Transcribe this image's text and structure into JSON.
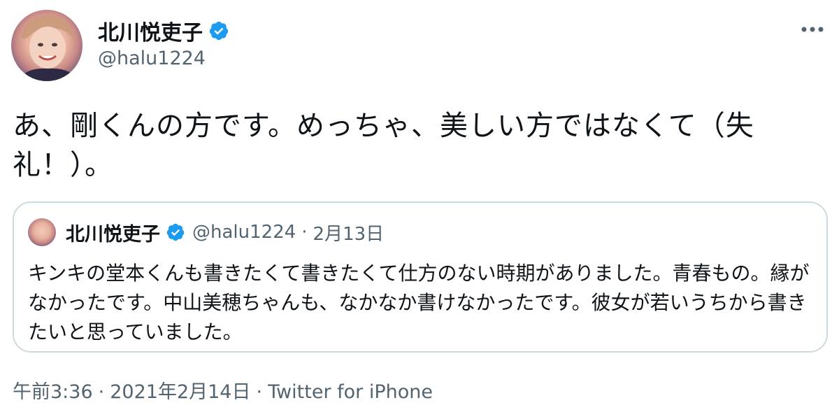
{
  "tweet": {
    "author": {
      "display_name": "北川悦吏子",
      "handle": "@halu1224"
    },
    "text": "あ、剛くんの方です。めっちゃ、美しい方ではなくて（失礼！）。",
    "quoted": {
      "display_name": "北川悦吏子",
      "handle": "@halu1224",
      "separator": "·",
      "date": "2月13日",
      "text": "キンキの堂本くんも書きたくて書きたくて仕方のない時期がありました。青春もの。縁がなかったです。中山美穂ちゃんも、なかなか書けなかったです。彼女が若いうちから書きたいと思っていました。"
    },
    "footer": {
      "time": "午前3:36",
      "separator": "·",
      "date": "2021年2月14日",
      "separator2": "·",
      "source": "Twitter for iPhone"
    }
  },
  "icons": {
    "verified": "verified-badge-icon",
    "more": "more-options-icon"
  },
  "colors": {
    "text_primary": "#0f1419",
    "text_secondary": "#536471",
    "verified_blue": "#1d9bf0",
    "border": "#cfd9de"
  }
}
